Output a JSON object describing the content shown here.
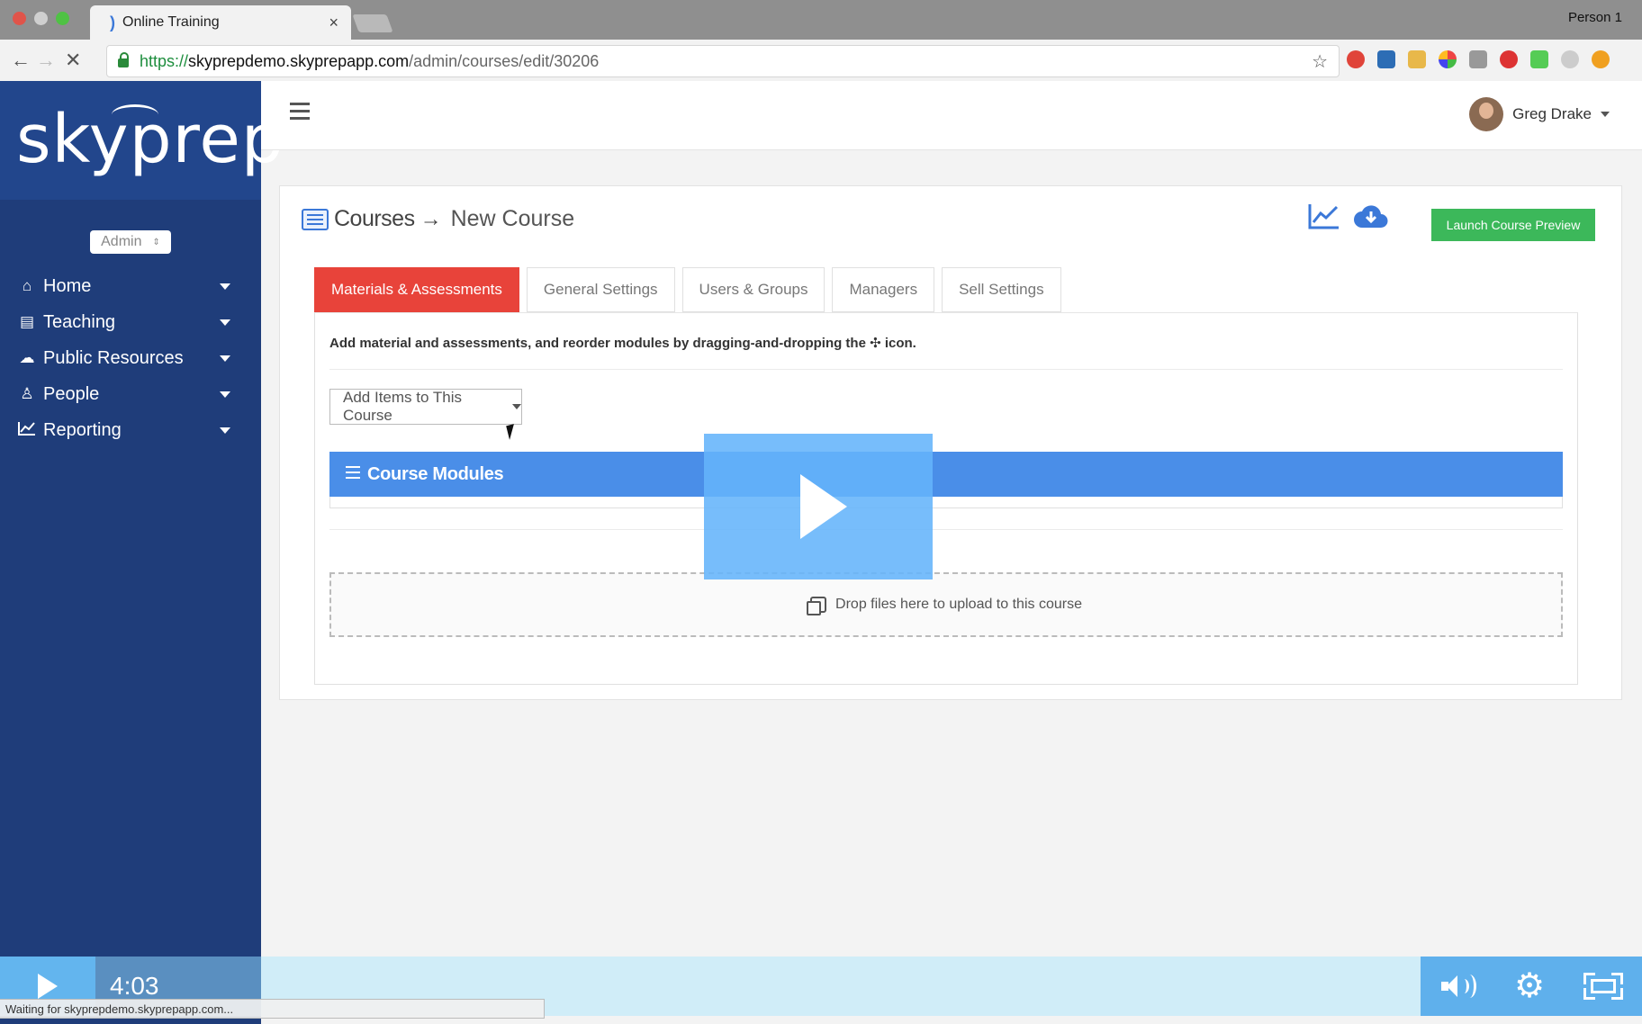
{
  "browser": {
    "tab_title": "Online Training",
    "tab_close": "×",
    "profile": "Person 1",
    "url_scheme": "https://",
    "url_host": "skyprepdemo.skyprepapp.com",
    "url_path": "/admin/courses/edit/30206",
    "status_text": "Waiting for skyprepdemo.skyprepapp.com..."
  },
  "sidebar": {
    "logo": "skyprep",
    "role_select": "Admin",
    "items": [
      {
        "label": "Home",
        "icon": "home-icon"
      },
      {
        "label": "Teaching",
        "icon": "book-icon"
      },
      {
        "label": "Public Resources",
        "icon": "cloud-icon"
      },
      {
        "label": "People",
        "icon": "person-icon"
      },
      {
        "label": "Reporting",
        "icon": "line-chart-icon"
      }
    ]
  },
  "topbar": {
    "user_name": "Greg Drake"
  },
  "page": {
    "breadcrumb_root": "Courses",
    "breadcrumb_arrow": "→",
    "breadcrumb_current": "New Course",
    "launch_button": "Launch Course Preview",
    "tabs": [
      {
        "label": "Materials & Assessments",
        "active": true
      },
      {
        "label": "General Settings",
        "active": false
      },
      {
        "label": "Users & Groups",
        "active": false
      },
      {
        "label": "Managers",
        "active": false
      },
      {
        "label": "Sell Settings",
        "active": false
      }
    ],
    "help_text": "Add material and assessments, and reorder modules by dragging-and-dropping the ✣ icon.",
    "add_items_button": "Add Items to This Course",
    "modules_title": "Course Modules",
    "drop_text": "Drop files here to upload to this course"
  },
  "video": {
    "time": "4:03"
  },
  "colors": {
    "sidebar_bg": "#1f3d7a",
    "active_tab": "#e8433a",
    "launch_button": "#3cb85a",
    "modules_header": "#4a8ee8",
    "player_accent": "#63b5ee"
  }
}
